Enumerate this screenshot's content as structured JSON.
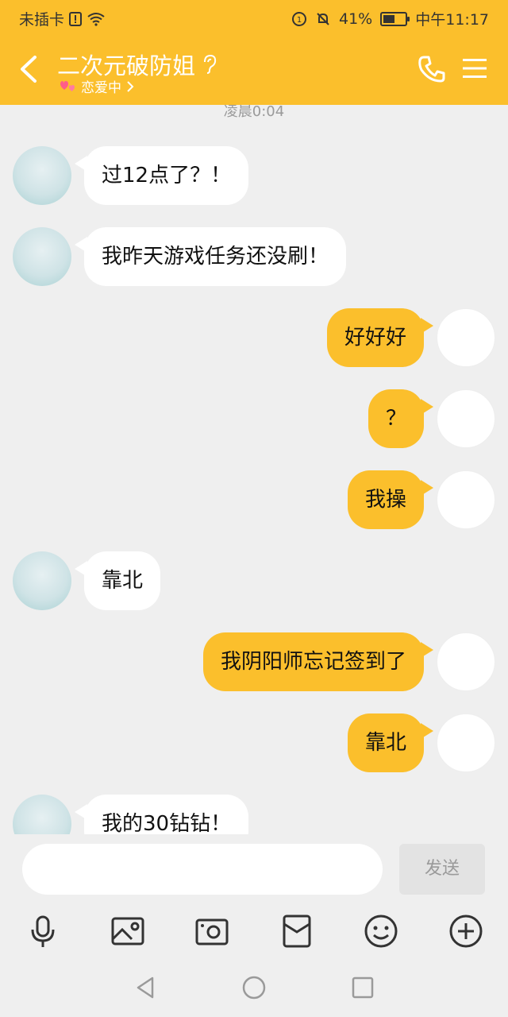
{
  "status_bar": {
    "carrier": "未插卡",
    "battery": "41%",
    "time": "中午11:17"
  },
  "header": {
    "title": "二次元破防姐",
    "subtitle": "恋爱中",
    "back_icon": "chevron-left-icon",
    "call_icon": "phone-icon",
    "menu_icon": "menu-icon"
  },
  "chat": {
    "timestamp": "凌晨0:04",
    "messages": [
      {
        "sender": "her",
        "text": "过12点了？！"
      },
      {
        "sender": "her",
        "text": "我昨天游戏任务还没刷！"
      },
      {
        "sender": "me",
        "text": "好好好"
      },
      {
        "sender": "me",
        "text": "？"
      },
      {
        "sender": "me",
        "text": "我操"
      },
      {
        "sender": "her",
        "text": "靠北"
      },
      {
        "sender": "me",
        "text": "我阴阳师忘记签到了"
      },
      {
        "sender": "me",
        "text": "靠北"
      },
      {
        "sender": "her",
        "text": "我的30钻钻！"
      }
    ]
  },
  "input": {
    "value": "",
    "placeholder": "",
    "send_label": "发送"
  },
  "toolbar": {
    "items": [
      "microphone-icon",
      "image-icon",
      "camera-icon",
      "red-packet-icon",
      "emoji-icon",
      "plus-icon"
    ]
  },
  "colors": {
    "accent": "#fbbf2c",
    "chat_background": "#efefef",
    "incoming_bubble": "#ffffff"
  }
}
